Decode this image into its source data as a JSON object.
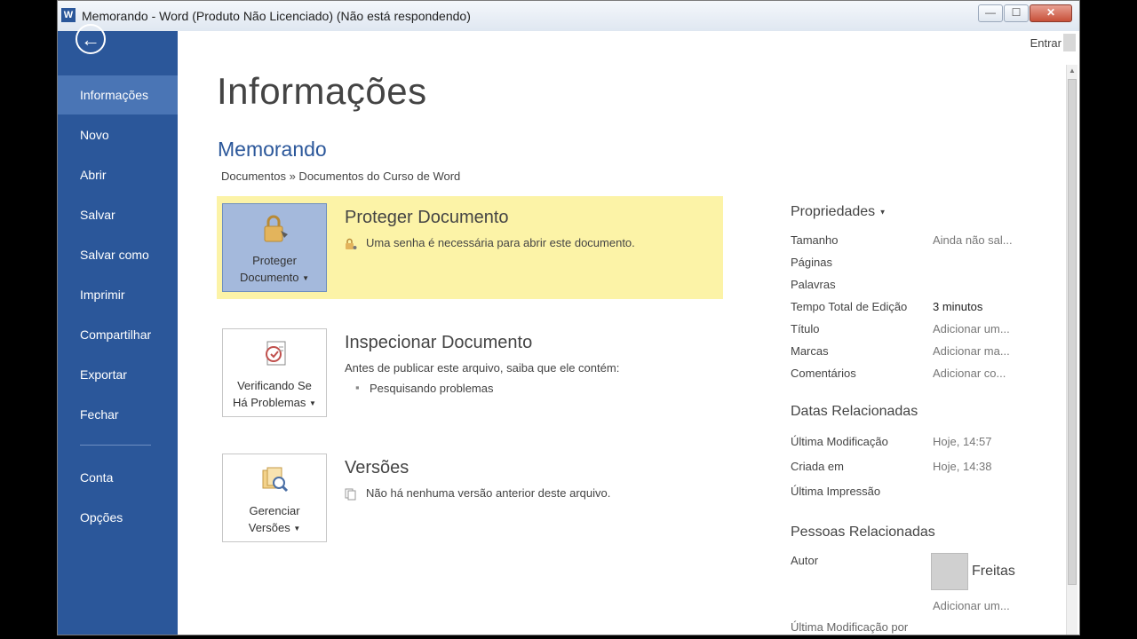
{
  "window": {
    "app_icon": "W",
    "title": "Memorando - Word (Produto Não Licenciado) (Não está respondendo)",
    "buttons": {
      "minimize": "—",
      "maximize": "☐",
      "close": "✕"
    }
  },
  "sidebar": {
    "back_icon": "←",
    "items": [
      {
        "label": "Informações",
        "active": true
      },
      {
        "label": "Novo"
      },
      {
        "label": "Abrir"
      },
      {
        "label": "Salvar"
      },
      {
        "label": "Salvar como"
      },
      {
        "label": "Imprimir"
      },
      {
        "label": "Compartilhar"
      },
      {
        "label": "Exportar"
      },
      {
        "label": "Fechar"
      },
      {
        "label": "Conta"
      },
      {
        "label": "Opções"
      }
    ]
  },
  "header": {
    "signin": "Entrar"
  },
  "main": {
    "title": "Informações",
    "doc_name": "Memorando",
    "doc_path": "Documentos » Documentos do Curso de Word",
    "protect": {
      "button_line1": "Proteger",
      "button_line2": "Documento",
      "title": "Proteger Documento",
      "desc": "Uma senha é necessária para abrir este documento."
    },
    "inspect": {
      "button_line1": "Verificando Se",
      "button_line2": "Há Problemas",
      "title": "Inspecionar Documento",
      "desc": "Antes de publicar este arquivo, saiba que ele contém:",
      "bullet": "Pesquisando problemas"
    },
    "versions": {
      "button_line1": "Gerenciar",
      "button_line2": "Versões",
      "title": "Versões",
      "desc": "Não há nenhuma versão anterior deste arquivo."
    }
  },
  "properties": {
    "heading": "Propriedades",
    "rows": [
      {
        "key": "Tamanho",
        "value": "Ainda não sal..."
      },
      {
        "key": "Páginas",
        "value": ""
      },
      {
        "key": "Palavras",
        "value": ""
      },
      {
        "key": "Tempo Total de Edição",
        "value": "3 minutos"
      },
      {
        "key": "Título",
        "value": "Adicionar um..."
      },
      {
        "key": "Marcas",
        "value": "Adicionar ma..."
      },
      {
        "key": "Comentários",
        "value": "Adicionar co..."
      }
    ],
    "dates_heading": "Datas Relacionadas",
    "dates": [
      {
        "key": "Última Modificação",
        "value": "Hoje, 14:57"
      },
      {
        "key": "Criada em",
        "value": "Hoje, 14:38"
      },
      {
        "key": "Última Impressão",
        "value": ""
      }
    ],
    "people_heading": "Pessoas Relacionadas",
    "author_label": "Autor",
    "author_name": "Freitas",
    "author_add": "Adicionar um...",
    "last_modified_by": "Última Modificação por"
  }
}
